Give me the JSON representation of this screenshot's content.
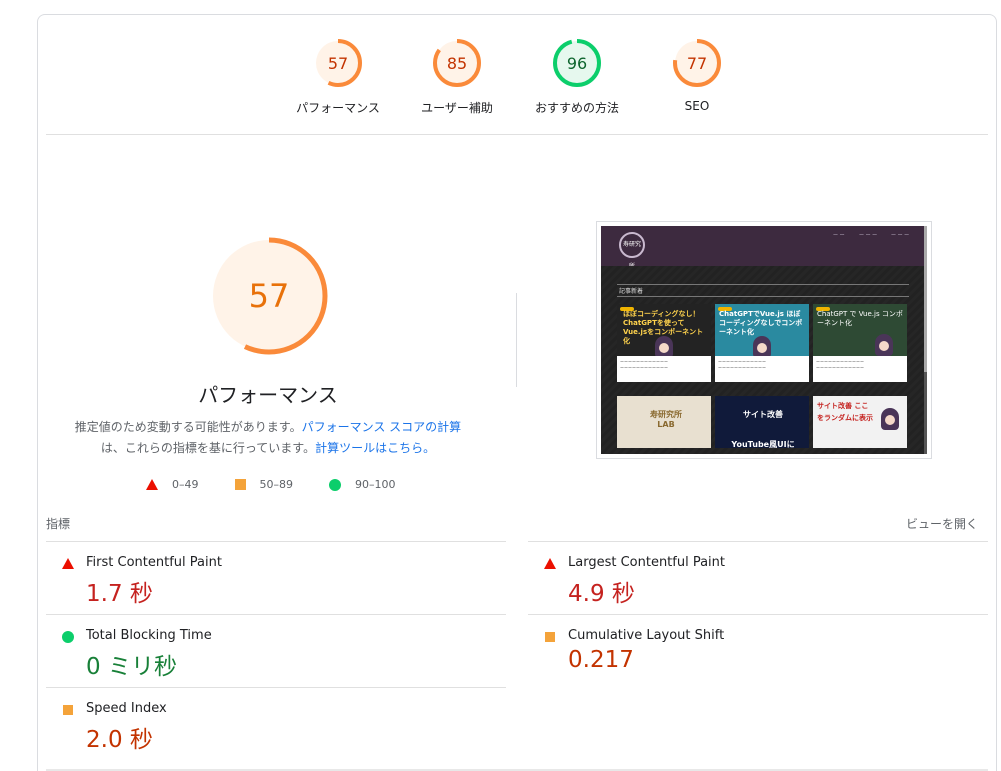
{
  "gauges": [
    {
      "score": "57",
      "label": "パフォーマンス",
      "fraction": 0.57,
      "color": "#fa8a3a",
      "bg": "#fff3e8",
      "text_color": "#c33300"
    },
    {
      "score": "85",
      "label": "ユーザー補助",
      "fraction": 0.85,
      "color": "#fa8a3a",
      "bg": "#fff3e8",
      "text_color": "#c33300"
    },
    {
      "score": "96",
      "label": "おすすめの方法",
      "fraction": 0.96,
      "color": "#0cce6b",
      "bg": "#e6f8ee",
      "text_color": "#0d652d"
    },
    {
      "score": "77",
      "label": "SEO",
      "fraction": 0.77,
      "color": "#fa8a3a",
      "bg": "#fff3e8",
      "text_color": "#c33300"
    }
  ],
  "main": {
    "score": "57",
    "fraction": 0.57,
    "title": "パフォーマンス",
    "desc_part1": "推定値のため変動する可能性があります。",
    "desc_link1": "パフォーマンス スコアの計算",
    "desc_part2": "は、これらの指標を基に行っています。",
    "desc_link2": "計算ツールはこちら。"
  },
  "legend": [
    {
      "icon": "triangle",
      "range": "0–49",
      "color": "#eb0f00"
    },
    {
      "icon": "square",
      "range": "50–89",
      "color": "#f4a33a"
    },
    {
      "icon": "circle",
      "range": "90–100",
      "color": "#0cce6b"
    }
  ],
  "screenshot": {
    "logo": "寿研究所",
    "section": "記事新着",
    "card1_title": "ほぼコーディングなし！ChatGPTを使ってVue.jsをコンポーネント化",
    "card2_title": "ChatGPTでVue.js ほぼコーディングなしでコンポーネント化",
    "card3_title": "ChatGPT で Vue.js コンポーネント化",
    "card4_title": "寿研究所 LAB",
    "card5_title": "サイト改善 YouTube風UIに",
    "card6_title": "サイト改善 ここをランダムに表示"
  },
  "metrics": {
    "heading": "指標",
    "view_label": "ビューを開く",
    "items": [
      {
        "name": "First Contentful Paint",
        "value": "1.7 秒",
        "status": "fail"
      },
      {
        "name": "Largest Contentful Paint",
        "value": "4.9 秒",
        "status": "fail"
      },
      {
        "name": "Total Blocking Time",
        "value": "0 ミリ秒",
        "status": "pass"
      },
      {
        "name": "Cumulative Layout Shift",
        "value": "0.217",
        "status": "average"
      },
      {
        "name": "Speed Index",
        "value": "2.0 秒",
        "status": "average"
      }
    ]
  }
}
